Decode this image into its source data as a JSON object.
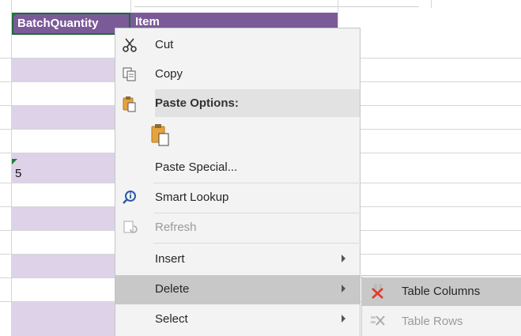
{
  "sheet": {
    "header_a": "BatchQuantity",
    "header_b": "Item",
    "cell_value": "5"
  },
  "menu": {
    "cut": "Cut",
    "copy": "Copy",
    "paste_options": "Paste Options:",
    "paste_special": "Paste Special...",
    "smart_lookup": "Smart Lookup",
    "refresh": "Refresh",
    "insert": "Insert",
    "delete": "Delete",
    "select": "Select"
  },
  "submenu": {
    "table_columns": "Table Columns",
    "table_rows": "Table Rows"
  },
  "colors": {
    "header_purple": "#7b5a98",
    "band_lavender": "#ddd2e8",
    "selection_green": "#1d6b3a",
    "menu_bg": "#f3f3f3",
    "hover_gray": "#c8c8c8"
  },
  "icons": [
    "scissors-icon",
    "copy-icon",
    "paste-icon",
    "paste-clipboard-icon",
    "smart-lookup-icon",
    "refresh-icon",
    "delete-columns-icon",
    "delete-rows-icon"
  ]
}
